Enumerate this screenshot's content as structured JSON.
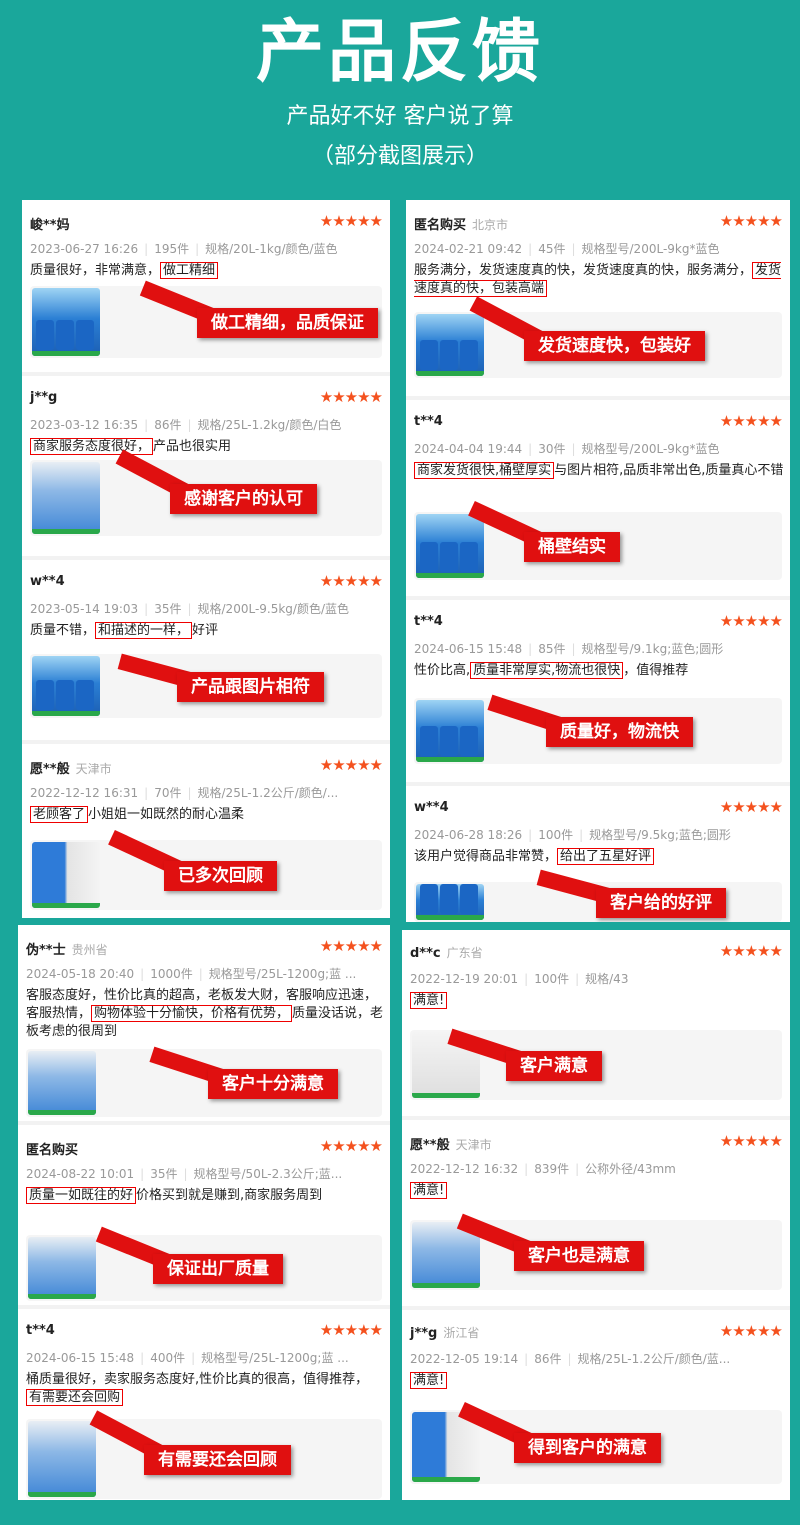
{
  "header": {
    "title": "产品反馈",
    "subtitle": "产品好不好 客户说了算",
    "note": "（部分截图展示）"
  },
  "stars": "★★★★★",
  "left_top": [
    {
      "user": "峻**妈",
      "location": "",
      "date": "2023-06-27 16:26",
      "qty": "195件",
      "spec": "规格/20L-1kg/颜色/蓝色",
      "pre": "质量很好，非常满意，",
      "hl": "做工精细",
      "post": "",
      "callout": "做工精细，品质保证"
    },
    {
      "user": "j**g",
      "location": "",
      "date": "2023-03-12 16:35",
      "qty": "86件",
      "spec": "规格/25L-1.2kg/颜色/白色",
      "pre": "",
      "hl": "商家服务态度很好，",
      "post": "产品也很实用",
      "callout": "感谢客户的认可"
    },
    {
      "user": "w**4",
      "location": "",
      "date": "2023-05-14 19:03",
      "qty": "35件",
      "spec": "规格/200L-9.5kg/颜色/蓝色",
      "pre": "质量不错，",
      "hl": "和描述的一样，",
      "post": "好评",
      "callout": "产品跟图片相符"
    },
    {
      "user": "愿**般",
      "location": "天津市",
      "date": "2022-12-12 16:31",
      "qty": "70件",
      "spec": "规格/25L-1.2公斤/颜色/...",
      "pre": "",
      "hl": "老顾客了",
      "post": "小姐姐一如既然的耐心温柔",
      "callout": "已多次回顾"
    }
  ],
  "right_top": [
    {
      "user": "匿名购买",
      "location": "北京市",
      "date": "2024-02-21 09:42",
      "qty": "45件",
      "spec": "规格型号/200L-9kg*蓝色",
      "pre": "服务满分，发货速度真的快，发货速度真的快，服务满分，",
      "hl": "发货速度真的快，包装高端",
      "post": "",
      "callout": "发货速度快，包装好"
    },
    {
      "user": "t**4",
      "location": "",
      "date": "2024-04-04 19:44",
      "qty": "30件",
      "spec": "规格型号/200L-9kg*蓝色",
      "pre": "",
      "hl": "商家发货很快,桶壁厚实",
      "post": "与图片相符,品质非常出色,质量真心不错",
      "callout": "桶壁结实"
    },
    {
      "user": "t**4",
      "location": "",
      "date": "2024-06-15 15:48",
      "qty": "85件",
      "spec": "规格型号/9.1kg;蓝色;圆形",
      "pre": "性价比高,",
      "hl": "质量非常厚实,物流也很快",
      "post": "，值得推荐",
      "callout": "质量好，物流快"
    },
    {
      "user": "w**4",
      "location": "",
      "date": "2024-06-28 18:26",
      "qty": "100件",
      "spec": "规格型号/9.5kg;蓝色;圆形",
      "pre": "该用户觉得商品非常赞，",
      "hl": "给出了五星好评",
      "post": "",
      "callout": "客户给的好评"
    }
  ],
  "left_bottom": [
    {
      "user": "伪**士",
      "location": "贵州省",
      "date": "2024-05-18 20:40",
      "qty": "1000件",
      "spec": "规格型号/25L-1200g;蓝 ...",
      "pre": "客服态度好，性价比真的超高，老板发大财，客服响应迅速，客服热情，",
      "hl": "购物体验十分愉快，价格有优势，",
      "post": "质量没话说，老板考虑的很周到",
      "callout": "客户十分满意"
    },
    {
      "user": "匿名购买",
      "location": "",
      "date": "2024-08-22 10:01",
      "qty": "35件",
      "spec": "规格型号/50L-2.3公斤;蓝...",
      "pre": "",
      "hl": "质量一如既往的好",
      "post": "价格买到就是赚到,商家服务周到",
      "callout": "保证出厂质量"
    },
    {
      "user": "t**4",
      "location": "",
      "date": "2024-06-15 15:48",
      "qty": "400件",
      "spec": "规格型号/25L-1200g;蓝 ...",
      "pre": "桶质量很好，卖家服务态度好,性价比真的很高，值得推荐，",
      "hl": "有需要还会回购",
      "post": "",
      "callout": "有需要还会回顾"
    }
  ],
  "right_bottom": [
    {
      "user": "d**c",
      "location": "广东省",
      "date": "2022-12-19 20:01",
      "qty": "100件",
      "spec": "规格/43",
      "pre": "",
      "hl": "满意!",
      "post": "",
      "callout": "客户满意"
    },
    {
      "user": "愿**般",
      "location": "天津市",
      "date": "2022-12-12 16:32",
      "qty": "839件",
      "spec": "公称外径/43mm",
      "pre": "",
      "hl": "满意!",
      "post": "",
      "callout": "客户也是满意"
    },
    {
      "user": "j**g",
      "location": "浙江省",
      "date": "2022-12-05 19:14",
      "qty": "86件",
      "spec": "规格/25L-1.2公斤/颜色/蓝...",
      "pre": "",
      "hl": "满意!",
      "post": "",
      "callout": "得到客户的满意"
    }
  ]
}
